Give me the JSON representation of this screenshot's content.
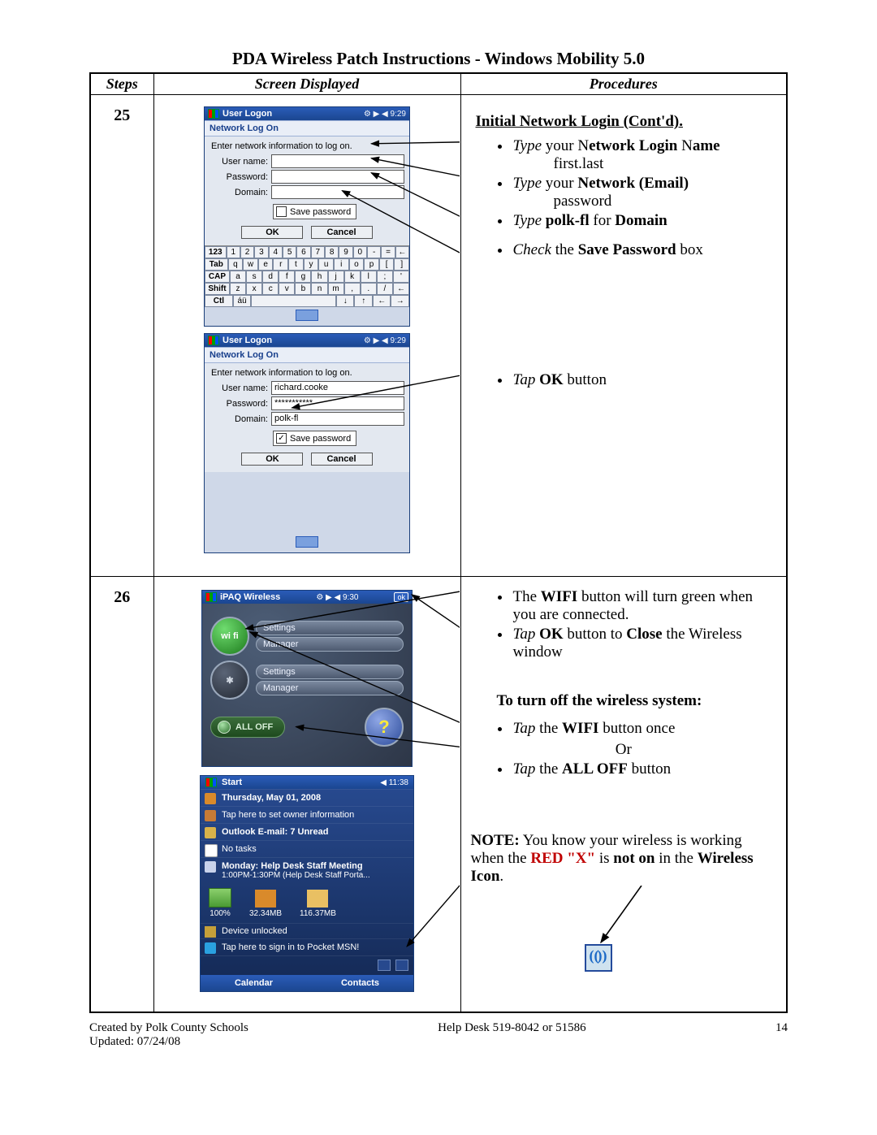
{
  "title": "PDA Wireless Patch Instructions - Windows Mobility 5.0",
  "table_headers": {
    "steps": "Steps",
    "screen": "Screen Displayed",
    "proc": "Procedures"
  },
  "row25": {
    "step": "25",
    "heading": "Initial Network Login (Cont'd).",
    "bullets": {
      "b1_a": "Type",
      "b1_b": " your N",
      "b1_c": "etwork Login",
      "b1_d": " N",
      "b1_e": "ame",
      "b1_sub": "first.last",
      "b2_a": "Type",
      "b2_b": " your ",
      "b2_c": "Network (Email)",
      "b2_sub": "password",
      "b3_a": "Type",
      "b3_b": " polk-fl",
      "b3_c": " for ",
      "b3_d": "Domain",
      "b4_a": "Check",
      "b4_b": " the ",
      "b4_c": "Save Password",
      "b4_d": " box",
      "b5_a": "Tap ",
      "b5_b": "OK",
      "b5_c": " button"
    },
    "pda1": {
      "bar_title": "User Logon",
      "bar_right": "⚙ ▶ ◀ 9:29",
      "subhead": "Network Log On",
      "prompt": "Enter network information to log on.",
      "labels": {
        "user": "User name:",
        "pass": "Password:",
        "domain": "Domain:"
      },
      "vals": {
        "user": "",
        "pass": "",
        "domain": ""
      },
      "save_label": "Save password",
      "save_checked": "false",
      "btn_ok": "OK",
      "btn_cancel": "Cancel",
      "kb": {
        "r1": [
          "123",
          "1",
          "2",
          "3",
          "4",
          "5",
          "6",
          "7",
          "8",
          "9",
          "0",
          "-",
          "=",
          "←"
        ],
        "r2": [
          "Tab",
          "q",
          "w",
          "e",
          "r",
          "t",
          "y",
          "u",
          "i",
          "o",
          "p",
          "[",
          "]"
        ],
        "r3": [
          "CAP",
          "a",
          "s",
          "d",
          "f",
          "g",
          "h",
          "j",
          "k",
          "l",
          ";",
          "'"
        ],
        "r4": [
          "Shift",
          "z",
          "x",
          "c",
          "v",
          "b",
          "n",
          "m",
          ",",
          ".",
          "/",
          "←"
        ],
        "r5": [
          "Ctl",
          "áü",
          " ",
          "↓",
          "↑",
          "←",
          "→"
        ]
      }
    },
    "pda2": {
      "bar_title": "User Logon",
      "bar_right": "⚙ ▶ ◀ 9:29",
      "subhead": "Network Log On",
      "prompt": "Enter network information to log on.",
      "labels": {
        "user": "User name:",
        "pass": "Password:",
        "domain": "Domain:"
      },
      "vals": {
        "user": "richard.cooke",
        "pass": "***********",
        "domain": "polk-fl"
      },
      "save_label": "Save password",
      "save_checked": "true",
      "btn_ok": "OK",
      "btn_cancel": "Cancel"
    }
  },
  "row26": {
    "step": "26",
    "ipaq": {
      "bar_title": "iPAQ Wireless",
      "bar_right": "⚙ ▶ ◀ 9:30",
      "ok": "ok",
      "wifi_label": "wi fi",
      "bt_label": "✱",
      "settings": "Settings",
      "manager": "Manager",
      "alloff": "ALL OFF",
      "help": "?"
    },
    "today": {
      "start": "Start",
      "bar_right": "◀ 11:38",
      "date": "Thursday, May 01, 2008",
      "owner": "Tap here to set owner information",
      "mail": "Outlook E-mail: 7 Unread",
      "tasks": "No tasks",
      "meeting_title": "Monday: Help Desk Staff Meeting",
      "meeting_sub": "1:00PM-1:30PM (Help Desk Staff Porta...",
      "bat": "100%",
      "ram": "32.34MB",
      "stor": "116.37MB",
      "unlock": "Device unlocked",
      "msn": "Tap here to sign in to Pocket MSN!",
      "soft_left": "Calendar",
      "soft_right": "Contacts"
    },
    "proc": {
      "p1_a": "The ",
      "p1_b": "WIFI",
      "p1_c": " button will turn green when you are connected.",
      "p2_a": "Tap ",
      "p2_b": "OK",
      "p2_c": " button to ",
      "p2_d": "Close",
      "p2_e": " the Wireless  window",
      "subhead": "To turn off the wireless system:",
      "p3_a": "Tap",
      "p3_b": " the ",
      "p3_c": "WIFI",
      "p3_d": " button once",
      "or": "Or",
      "p4_a": "Tap",
      "p4_b": " the ",
      "p4_c": "ALL OFF",
      "p4_d": " button",
      "note_a": "NOTE:",
      "note_b": " You know your wireless is working when the ",
      "note_c": "RED \"X\"",
      "note_d": " is ",
      "note_e": "not on",
      "note_f": " in the ",
      "note_g": "Wireless Icon",
      "note_h": "."
    }
  },
  "footer": {
    "left1": "Created by Polk County Schools",
    "left2": "Updated: 07/24/08",
    "mid": "Help Desk 519-8042 or 51586",
    "right": "14"
  }
}
